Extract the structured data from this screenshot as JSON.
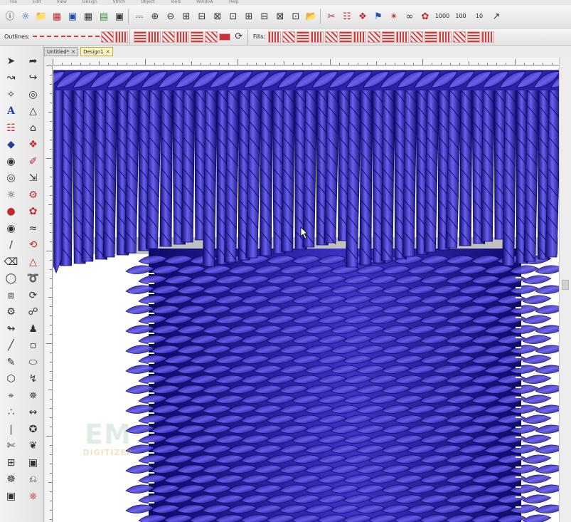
{
  "menubar": {
    "items": [
      "File",
      "Edit",
      "View",
      "Design",
      "Stitch",
      "Object",
      "Tools",
      "Window",
      "Help"
    ]
  },
  "toolbar_bottom": {
    "outlines_label": "Outlines:",
    "fills_label": "Fills:"
  },
  "tabs": [
    {
      "label": "Untitled*"
    },
    {
      "label": "Design1"
    }
  ],
  "watermark": {
    "line1": "EM",
    "line2": "DIGITIZER"
  },
  "colors": {
    "thread": "#3c33c8",
    "thread_dark": "#0e0a6b",
    "thread_mid": "#2a22a6",
    "thread_highlight": "#6a5ff0",
    "shadow": "#8c8c8c",
    "canvas_bg": "#ffffff",
    "watermark_green": "#4f9a64",
    "watermark_gold": "#d3a342"
  },
  "icons": {
    "tb1": [
      "info-icon",
      "palette-icon",
      "open-folder-icon",
      "color-grid-icon",
      "monitor-icon",
      "grid-icon",
      "thread-chart-icon",
      "save-icon",
      "hoop-icon",
      "zoom-in-icon",
      "zoom-out-icon",
      "arrange-icon",
      "align-icon",
      "order-icon",
      "transform-icon",
      "folder-icon",
      "scissors-icon",
      "stitch-icon",
      "needle-icon",
      "flag-icon"
    ],
    "tools": [
      "select-arrow-icon",
      "reshape-icon",
      "node-icon",
      "lasso-icon",
      "text-icon",
      "shape-icon",
      "color-icon",
      "fill-icon",
      "circle-icon",
      "star-icon",
      "sun-icon",
      "gear-icon",
      "brush-icon",
      "eraser-icon",
      "line-icon",
      "curve-icon"
    ]
  },
  "toolbar_small": [
    "1000",
    "100",
    "10"
  ]
}
